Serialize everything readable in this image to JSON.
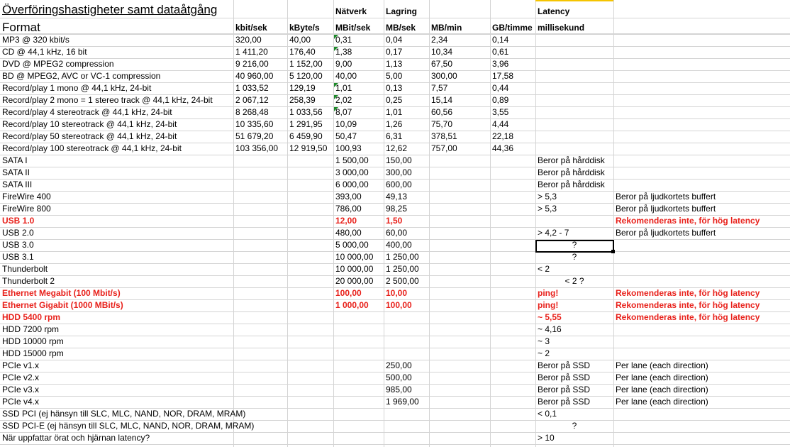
{
  "title": "Överföringshastigheter samt dataåtgång",
  "top_headers": {
    "network": "Nätverk",
    "storage": "Lagring",
    "latency": "Latency"
  },
  "headers": [
    "Format",
    "kbit/sek",
    "kByte/s",
    "MBit/sek",
    "MB/sek",
    "MB/min",
    "GB/timme",
    "millisekund"
  ],
  "rows": [
    {
      "cells": [
        "MP3 @ 320 kbit/s",
        "320,00",
        "40,00",
        "0,31",
        "0,04",
        "2,34",
        "0,14",
        "",
        ""
      ],
      "tri": true
    },
    {
      "cells": [
        "CD @ 44,1 kHz, 16 bit",
        "1 411,20",
        "176,40",
        "1,38",
        "0,17",
        "10,34",
        "0,61",
        "",
        ""
      ],
      "tri": true
    },
    {
      "cells": [
        "DVD @ MPEG2 compression",
        "9 216,00",
        "1 152,00",
        "9,00",
        "1,13",
        "67,50",
        "3,96",
        "",
        ""
      ]
    },
    {
      "cells": [
        "BD @ MPEG2, AVC or VC-1 compression",
        "40 960,00",
        "5 120,00",
        "40,00",
        "5,00",
        "300,00",
        "17,58",
        "",
        ""
      ]
    },
    {
      "cells": [
        "Record/play 1 mono @ 44,1 kHz, 24-bit",
        "1 033,52",
        "129,19",
        "1,01",
        "0,13",
        "7,57",
        "0,44",
        "",
        ""
      ],
      "tri": true
    },
    {
      "cells": [
        "Record/play 2 mono = 1 stereo track @ 44,1 kHz, 24-bit",
        "2 067,12",
        "258,39",
        "2,02",
        "0,25",
        "15,14",
        "0,89",
        "",
        ""
      ],
      "tri": true
    },
    {
      "cells": [
        "Record/play 4 stereotrack @ 44,1 kHz, 24-bit",
        "8 268,48",
        "1 033,56",
        "8,07",
        "1,01",
        "60,56",
        "3,55",
        "",
        ""
      ],
      "tri": true
    },
    {
      "cells": [
        "Record/play 10 stereotrack @ 44,1 kHz, 24-bit",
        "10 335,60",
        "1 291,95",
        "10,09",
        "1,26",
        "75,70",
        "4,44",
        "",
        ""
      ]
    },
    {
      "cells": [
        "Record/play 50 stereotrack @ 44,1 kHz, 24-bit",
        "51 679,20",
        "6 459,90",
        "50,47",
        "6,31",
        "378,51",
        "22,18",
        "",
        ""
      ]
    },
    {
      "cells": [
        "Record/play 100 stereotrack @ 44,1 kHz, 24-bit",
        "103 356,00",
        "12 919,50",
        "100,93",
        "12,62",
        "757,00",
        "44,36",
        "",
        ""
      ]
    },
    {
      "cells": [
        "SATA I",
        "",
        "",
        "1 500,00",
        "150,00",
        "",
        "",
        "Beror på hårddisk",
        ""
      ]
    },
    {
      "cells": [
        "SATA II",
        "",
        "",
        "3 000,00",
        "300,00",
        "",
        "",
        "Beror på hårddisk",
        ""
      ]
    },
    {
      "cells": [
        "SATA III",
        "",
        "",
        "6 000,00",
        "600,00",
        "",
        "",
        "Beror på hårddisk",
        ""
      ]
    },
    {
      "cells": [
        "FireWire 400",
        "",
        "",
        "393,00",
        "49,13",
        "",
        "",
        "> 5,3",
        "Beror på ljudkortets buffert"
      ]
    },
    {
      "cells": [
        "FireWire 800",
        "",
        "",
        "786,00",
        "98,25",
        "",
        "",
        "> 5,3",
        "Beror på ljudkortets buffert"
      ]
    },
    {
      "cells": [
        "USB 1.0",
        "",
        "",
        "12,00",
        "1,50",
        "",
        "",
        "",
        "Rekomenderas inte, för hög latency"
      ],
      "red": true
    },
    {
      "cells": [
        "USB 2.0",
        "",
        "",
        "480,00",
        "60,00",
        "",
        "",
        "> 4,2 - 7",
        "Beror på ljudkortets buffert"
      ]
    },
    {
      "cells": [
        "USB 3.0",
        "",
        "",
        "5 000,00",
        "400,00",
        "",
        "",
        "?",
        ""
      ],
      "center_latency": true
    },
    {
      "cells": [
        "USB 3.1",
        "",
        "",
        "10 000,00",
        "1 250,00",
        "",
        "",
        "?",
        ""
      ],
      "center_latency": true
    },
    {
      "cells": [
        "Thunderbolt",
        "",
        "",
        "10 000,00",
        "1 250,00",
        "",
        "",
        "< 2",
        ""
      ]
    },
    {
      "cells": [
        "Thunderbolt 2",
        "",
        "",
        "20 000,00",
        "2 500,00",
        "",
        "",
        "< 2 ?",
        ""
      ],
      "center_latency": true
    },
    {
      "cells": [
        "Ethernet Megabit (100 Mbit/s)",
        "",
        "",
        "100,00",
        "10,00",
        "",
        "",
        "ping!",
        "Rekomenderas inte, för hög latency"
      ],
      "red": true
    },
    {
      "cells": [
        "Ethernet Gigabit (1000 MBit/s)",
        "",
        "",
        "1 000,00",
        "100,00",
        "",
        "",
        "ping!",
        "Rekomenderas inte, för hög latency"
      ],
      "red": true
    },
    {
      "cells": [
        "HDD 5400 rpm",
        "",
        "",
        "",
        "",
        "",
        "",
        "~ 5,55",
        "Rekomenderas inte, för hög latency"
      ],
      "red": true
    },
    {
      "cells": [
        "HDD 7200 rpm",
        "",
        "",
        "",
        "",
        "",
        "",
        "~ 4,16",
        ""
      ]
    },
    {
      "cells": [
        "HDD 10000 rpm",
        "",
        "",
        "",
        "",
        "",
        "",
        "~ 3",
        ""
      ]
    },
    {
      "cells": [
        "HDD 15000 rpm",
        "",
        "",
        "",
        "",
        "",
        "",
        "~ 2",
        ""
      ]
    },
    {
      "cells": [
        "PCIe v1.x",
        "",
        "",
        "",
        "250,00",
        "",
        "",
        "Beror på SSD",
        "Per lane (each direction)"
      ]
    },
    {
      "cells": [
        "PCIe v2.x",
        "",
        "",
        "",
        "500,00",
        "",
        "",
        "Beror på SSD",
        "Per lane (each direction)"
      ]
    },
    {
      "cells": [
        "PCIe v3.x",
        "",
        "",
        "",
        "985,00",
        "",
        "",
        "Beror på SSD",
        "Per lane (each direction)"
      ]
    },
    {
      "cells": [
        "PCIe v4.x",
        "",
        "",
        "",
        "1 969,00",
        "",
        "",
        "Beror på SSD",
        "Per lane (each direction)"
      ]
    },
    {
      "cells": [
        "SSD PCI (ej hänsyn till SLC, MLC, NAND, NOR, DRAM, MRAM)",
        "",
        "",
        "",
        "",
        "",
        "",
        "< 0,1",
        ""
      ]
    },
    {
      "cells": [
        "SSD PCI-E (ej hänsyn till SLC, MLC, NAND, NOR, DRAM, MRAM)",
        "",
        "",
        "",
        "",
        "",
        "",
        "?",
        ""
      ],
      "center_latency": true
    },
    {
      "cells": [
        "När uppfattar örat och hjärnan latency?",
        "",
        "",
        "",
        "",
        "",
        "",
        "> 10",
        ""
      ]
    }
  ],
  "colors": {
    "grid": "#d4d4d4",
    "warning_red": "#e8211b",
    "note_triangle": "#1e8a2a",
    "selection": "#000000",
    "header_accent": "#f5c400"
  }
}
